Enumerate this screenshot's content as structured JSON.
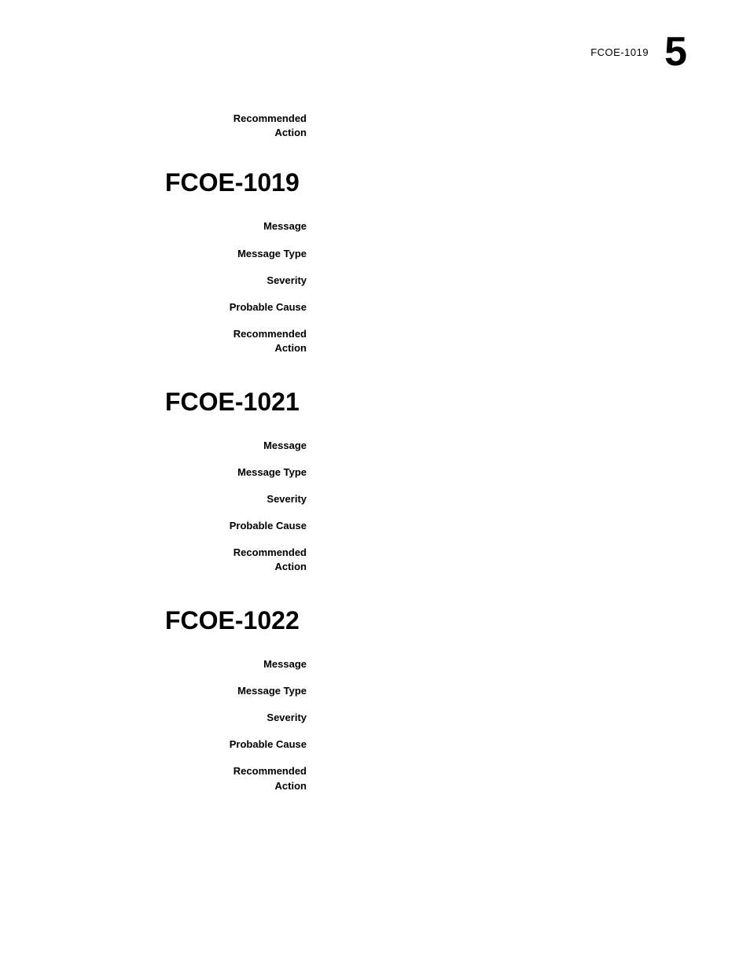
{
  "header": {
    "code": "FCOE-1019",
    "page_number": "5"
  },
  "standalone_recommended_action": {
    "label": "Recommended\nAction"
  },
  "sections": [
    {
      "id": "fcoe-1019",
      "title": "FCOE-1019",
      "fields": [
        {
          "label": "Message",
          "value": ""
        },
        {
          "label": "Message Type",
          "value": ""
        },
        {
          "label": "Severity",
          "value": ""
        },
        {
          "label": "Probable Cause",
          "value": ""
        },
        {
          "label": "Recommended\nAction",
          "value": ""
        }
      ]
    },
    {
      "id": "fcoe-1021",
      "title": "FCOE-1021",
      "fields": [
        {
          "label": "Message",
          "value": ""
        },
        {
          "label": "Message Type",
          "value": ""
        },
        {
          "label": "Severity",
          "value": ""
        },
        {
          "label": "Probable Cause",
          "value": ""
        },
        {
          "label": "Recommended\nAction",
          "value": ""
        }
      ]
    },
    {
      "id": "fcoe-1022",
      "title": "FCOE-1022",
      "fields": [
        {
          "label": "Message",
          "value": ""
        },
        {
          "label": "Message Type",
          "value": ""
        },
        {
          "label": "Severity",
          "value": ""
        },
        {
          "label": "Probable Cause",
          "value": ""
        },
        {
          "label": "Recommended\nAction",
          "value": ""
        }
      ]
    }
  ]
}
